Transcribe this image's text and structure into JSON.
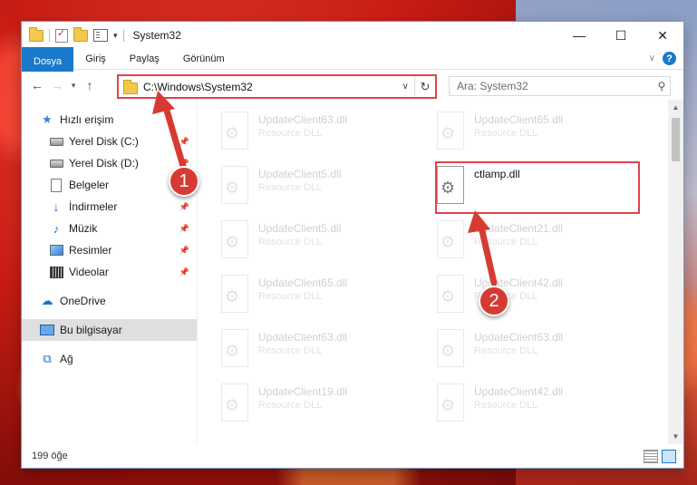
{
  "window": {
    "title": "System32",
    "caption": {
      "minimize": "—",
      "maximize": "☐",
      "close": "✕"
    }
  },
  "ribbon": {
    "tabs": [
      {
        "label": "Dosya"
      },
      {
        "label": "Giriş"
      },
      {
        "label": "Paylaş"
      },
      {
        "label": "Görünüm"
      }
    ],
    "help": "?"
  },
  "nav": {
    "back": "←",
    "forward": "→",
    "recent": "▾",
    "up": "↑",
    "address": "C:\\Windows\\System32",
    "search_placeholder": "Ara: System32"
  },
  "sidebar": {
    "items": [
      {
        "label": "Hızlı erişim"
      },
      {
        "label": "Yerel Disk (C:)"
      },
      {
        "label": "Yerel Disk (D:)"
      },
      {
        "label": "Belgeler"
      },
      {
        "label": "İndirmeler"
      },
      {
        "label": "Müzik"
      },
      {
        "label": "Resimler"
      },
      {
        "label": "Videolar"
      },
      {
        "label": "OneDrive"
      },
      {
        "label": "Bu bilgisayar"
      },
      {
        "label": "Ağ"
      }
    ]
  },
  "files": [
    {
      "name": "UpdateClient63.dll",
      "type": "Resource DLL"
    },
    {
      "name": "UpdateClient65.dll",
      "type": "Resource DLL"
    },
    {
      "name": "UpdateClient5.dll",
      "type": "Resource DLL"
    },
    {
      "name": "ctlamp.dll",
      "type": ""
    },
    {
      "name": "UpdateClient5.dll",
      "type": "Resource DLL"
    },
    {
      "name": "UpdateClient21.dll",
      "type": "Resource DLL"
    },
    {
      "name": "UpdateClient65.dll",
      "type": "Resource DLL"
    },
    {
      "name": "UpdateClient42.dll",
      "type": "Resource DLL"
    },
    {
      "name": "UpdateClient63.dll",
      "type": "Resource DLL"
    },
    {
      "name": "UpdateClient63.dll",
      "type": "Resource DLL"
    },
    {
      "name": "UpdateClient19.dll",
      "type": "Resource DLL"
    },
    {
      "name": "UpdateClient42.dll",
      "type": "Resource DLL"
    }
  ],
  "status": {
    "count": "199 öğe"
  },
  "callouts": {
    "one": "1",
    "two": "2"
  },
  "colors": {
    "accent": "#1979ca",
    "highlight": "#e0434a",
    "callout": "#d63b33"
  }
}
